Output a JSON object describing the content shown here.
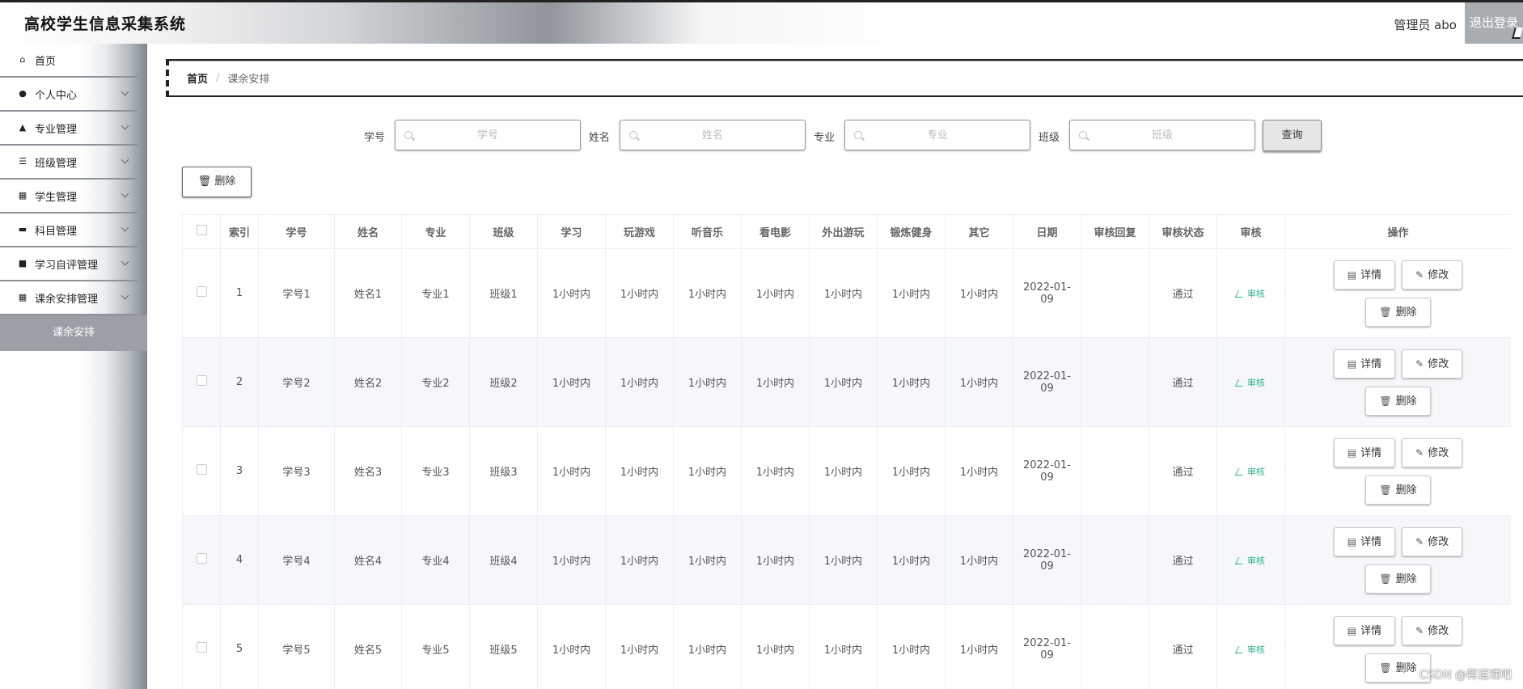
{
  "header": {
    "title": "高校学生信息采集系统",
    "admin_text": "管理员 abo",
    "logout_label": "退出登录"
  },
  "sidebar": {
    "items": [
      {
        "label": "首页",
        "icon": "home-icon",
        "has_children": false
      },
      {
        "label": "个人中心",
        "icon": "user-icon",
        "has_children": true
      },
      {
        "label": "专业管理",
        "icon": "user-badge-icon",
        "has_children": true
      },
      {
        "label": "班级管理",
        "icon": "list-icon",
        "has_children": true
      },
      {
        "label": "学生管理",
        "icon": "grid-icon",
        "has_children": true
      },
      {
        "label": "科目管理",
        "icon": "monitor-icon",
        "has_children": true
      },
      {
        "label": "学习自评管理",
        "icon": "briefcase-icon",
        "has_children": true
      },
      {
        "label": "课余安排管理",
        "icon": "grid-icon",
        "has_children": true
      }
    ],
    "active_sub": "课余安排"
  },
  "breadcrumb": {
    "home": "首页",
    "separator": "/",
    "current": "课余安排"
  },
  "search": {
    "fields": [
      {
        "label": "学号",
        "placeholder": "学号",
        "value": ""
      },
      {
        "label": "姓名",
        "placeholder": "姓名",
        "value": ""
      },
      {
        "label": "专业",
        "placeholder": "专业",
        "value": ""
      },
      {
        "label": "班级",
        "placeholder": "班级",
        "value": ""
      }
    ],
    "query_label": "查询"
  },
  "toolbar": {
    "delete_label": "删除"
  },
  "table": {
    "headers": [
      "",
      "索引",
      "学号",
      "姓名",
      "专业",
      "班级",
      "学习",
      "玩游戏",
      "听音乐",
      "看电影",
      "外出游玩",
      "锻炼健身",
      "其它",
      "日期",
      "审核回复",
      "审核状态",
      "审核",
      "操作"
    ],
    "rows": [
      {
        "index": "1",
        "sid": "学号1",
        "name": "姓名1",
        "major": "专业1",
        "cls": "班级1",
        "study": "1小时内",
        "game": "1小时内",
        "music": "1小时内",
        "movie": "1小时内",
        "outing": "1小时内",
        "exercise": "1小时内",
        "other": "1小时内",
        "date_a": "2022-01-",
        "date_b": "09",
        "reply": "",
        "status": "通过"
      },
      {
        "index": "2",
        "sid": "学号2",
        "name": "姓名2",
        "major": "专业2",
        "cls": "班级2",
        "study": "1小时内",
        "game": "1小时内",
        "music": "1小时内",
        "movie": "1小时内",
        "outing": "1小时内",
        "exercise": "1小时内",
        "other": "1小时内",
        "date_a": "2022-01-",
        "date_b": "09",
        "reply": "",
        "status": "通过"
      },
      {
        "index": "3",
        "sid": "学号3",
        "name": "姓名3",
        "major": "专业3",
        "cls": "班级3",
        "study": "1小时内",
        "game": "1小时内",
        "music": "1小时内",
        "movie": "1小时内",
        "outing": "1小时内",
        "exercise": "1小时内",
        "other": "1小时内",
        "date_a": "2022-01-",
        "date_b": "09",
        "reply": "",
        "status": "通过"
      },
      {
        "index": "4",
        "sid": "学号4",
        "name": "姓名4",
        "major": "专业4",
        "cls": "班级4",
        "study": "1小时内",
        "game": "1小时内",
        "music": "1小时内",
        "movie": "1小时内",
        "outing": "1小时内",
        "exercise": "1小时内",
        "other": "1小时内",
        "date_a": "2022-01-",
        "date_b": "09",
        "reply": "",
        "status": "通过"
      },
      {
        "index": "5",
        "sid": "学号5",
        "name": "姓名5",
        "major": "专业5",
        "cls": "班级5",
        "study": "1小时内",
        "game": "1小时内",
        "music": "1小时内",
        "movie": "1小时内",
        "outing": "1小时内",
        "exercise": "1小时内",
        "other": "1小时内",
        "date_a": "2022-01-",
        "date_b": "09",
        "reply": "",
        "status": "通过"
      }
    ],
    "audit_label": "审核",
    "detail_label": "详情",
    "edit_label": "修改",
    "delete_label": "删除"
  },
  "watermark": "CSDN @蒋道理吧"
}
